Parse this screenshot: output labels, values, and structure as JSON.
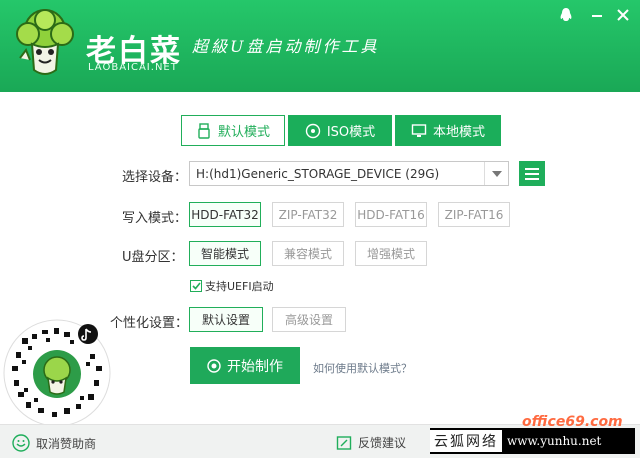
{
  "header": {
    "brand": "老白菜",
    "brand_sub": "LAOBAICAI.NET",
    "slogan": "超級U盘启动制作工具",
    "accent": "#1fae5b"
  },
  "tabs": [
    {
      "label": "默认模式",
      "icon": "usb-icon"
    },
    {
      "label": "ISO模式",
      "icon": "disc-icon"
    },
    {
      "label": "本地模式",
      "icon": "monitor-icon"
    }
  ],
  "device": {
    "label": "选择设备：",
    "value": "H:(hd1)Generic_STORAGE_DEVICE (29G)"
  },
  "write_mode": {
    "label": "写入模式：",
    "options": [
      "HDD-FAT32",
      "ZIP-FAT32",
      "HDD-FAT16",
      "ZIP-FAT16"
    ],
    "selected": "HDD-FAT32"
  },
  "partition": {
    "label": "U盘分区：",
    "options": [
      "智能模式",
      "兼容模式",
      "增强模式"
    ],
    "selected": "智能模式"
  },
  "uefi": {
    "label": "支持UEFI启动",
    "checked": true
  },
  "personalize": {
    "label": "个性化设置：",
    "options": [
      "默认设置",
      "高级设置"
    ],
    "selected": "默认设置"
  },
  "start_button": "开始制作",
  "help_link": "如何使用默认模式？",
  "footer": {
    "cancel_sponsor": "取消赞助商",
    "feedback": "反馈建议"
  },
  "watermark": {
    "cn": "云狐网络",
    "url": "www.yunhu.net",
    "red": "office69.com"
  }
}
